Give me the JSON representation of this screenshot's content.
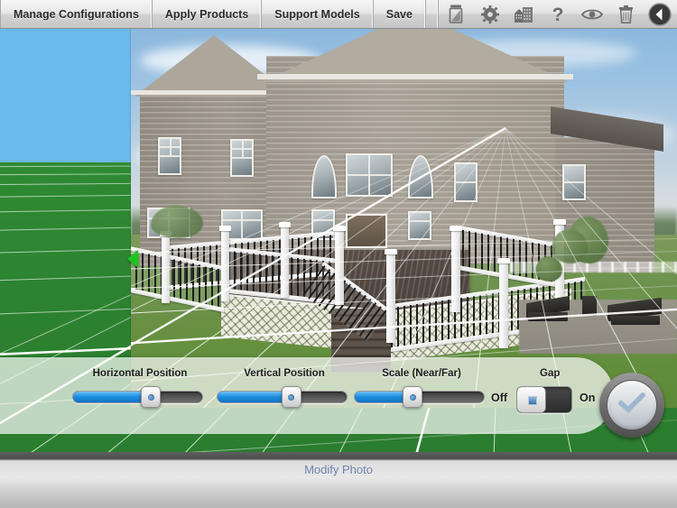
{
  "toolbar": {
    "menus": [
      {
        "label": "Manage Configurations",
        "name": "menu-manage-configurations"
      },
      {
        "label": "Apply Products",
        "name": "menu-apply-products"
      },
      {
        "label": "Support Models",
        "name": "menu-support-models"
      },
      {
        "label": "Save",
        "name": "menu-save"
      }
    ],
    "icons": [
      {
        "name": "photo-swap-icon",
        "title": "Photo"
      },
      {
        "name": "gear-icon",
        "title": "Settings"
      },
      {
        "name": "buildings-icon",
        "title": "Models"
      },
      {
        "name": "help-icon",
        "title": "Help"
      },
      {
        "name": "eye-icon",
        "title": "View"
      },
      {
        "name": "trash-icon",
        "title": "Delete"
      },
      {
        "name": "back-icon",
        "title": "Back"
      }
    ]
  },
  "controls": {
    "horizontal": {
      "label": "Horizontal Position",
      "value": 60
    },
    "vertical": {
      "label": "Vertical Position",
      "value": 57
    },
    "scale": {
      "label": "Scale (Near/Far)",
      "value": 45
    },
    "gap": {
      "label": "Gap",
      "off_label": "Off",
      "on_label": "On",
      "state": "Off"
    },
    "confirm": {
      "name": "confirm-button",
      "icon": "checkmark-icon"
    }
  },
  "bottom": {
    "link_label": "Modify Photo"
  },
  "colors": {
    "accent_blue": "#1e8fe0",
    "link_blue": "#6b7da8",
    "handle_green": "#1fc41f",
    "sky_blue": "#6cb9ec",
    "ground_green": "#2f8a33"
  }
}
